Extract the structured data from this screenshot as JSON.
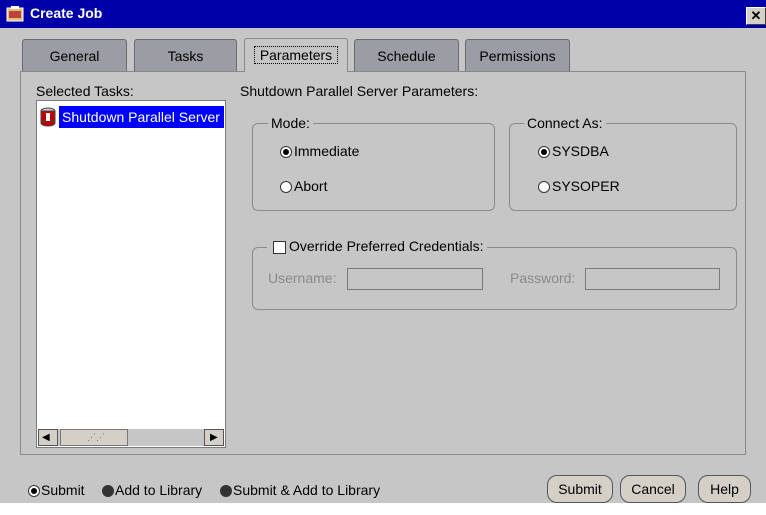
{
  "window": {
    "title": "Create Job",
    "close_glyph": "✕"
  },
  "tabs": [
    {
      "label": "General"
    },
    {
      "label": "Tasks"
    },
    {
      "label": "Parameters"
    },
    {
      "label": "Schedule"
    },
    {
      "label": "Permissions"
    }
  ],
  "active_tab": "Parameters",
  "tasks": {
    "label": "Selected Tasks:",
    "items": [
      {
        "label": "Shutdown Parallel Server",
        "selected": true,
        "icon": "database-stop-icon"
      }
    ],
    "scroll_left": "◀",
    "scroll_right": "▶",
    "scroll_grip": "⋰⋰"
  },
  "parameters": {
    "heading": "Shutdown Parallel Server Parameters:",
    "mode": {
      "label": "Mode:",
      "options": [
        {
          "label": "Immediate",
          "selected": true
        },
        {
          "label": "Abort",
          "selected": false
        }
      ]
    },
    "connect_as": {
      "label": "Connect As:",
      "options": [
        {
          "label": "SYSDBA",
          "selected": true
        },
        {
          "label": "SYSOPER",
          "selected": false
        }
      ]
    },
    "credentials": {
      "label": "Override Preferred Credentials:",
      "checked": false,
      "username_label": "Username:",
      "username_value": "",
      "password_label": "Password:",
      "password_value": ""
    }
  },
  "footer": {
    "options": [
      {
        "label": "Submit",
        "selected": true
      },
      {
        "label": "Add to Library",
        "selected": false
      },
      {
        "label": "Submit & Add to Library",
        "selected": false
      }
    ],
    "buttons": {
      "submit": "Submit",
      "cancel": "Cancel",
      "help": "Help"
    }
  },
  "colors": {
    "title_bar": "#0000a8",
    "selection": "#0000ff",
    "panel": "#c6c6c6",
    "tab_inactive": "#9c9ca4"
  }
}
